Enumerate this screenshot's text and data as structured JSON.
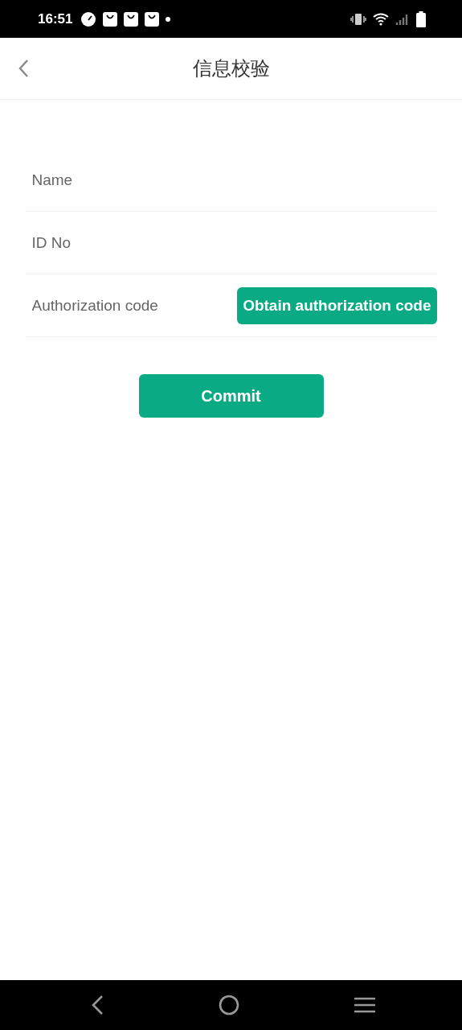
{
  "status_bar": {
    "time": "16:51"
  },
  "header": {
    "title": "信息校验"
  },
  "fields": [
    {
      "kind": "text",
      "placeholder": "Name"
    },
    {
      "kind": "text",
      "placeholder": "ID No"
    },
    {
      "kind": "code",
      "placeholder": "Authorization code",
      "button": "Obtain authorization code"
    }
  ],
  "submit_button": "Commit"
}
